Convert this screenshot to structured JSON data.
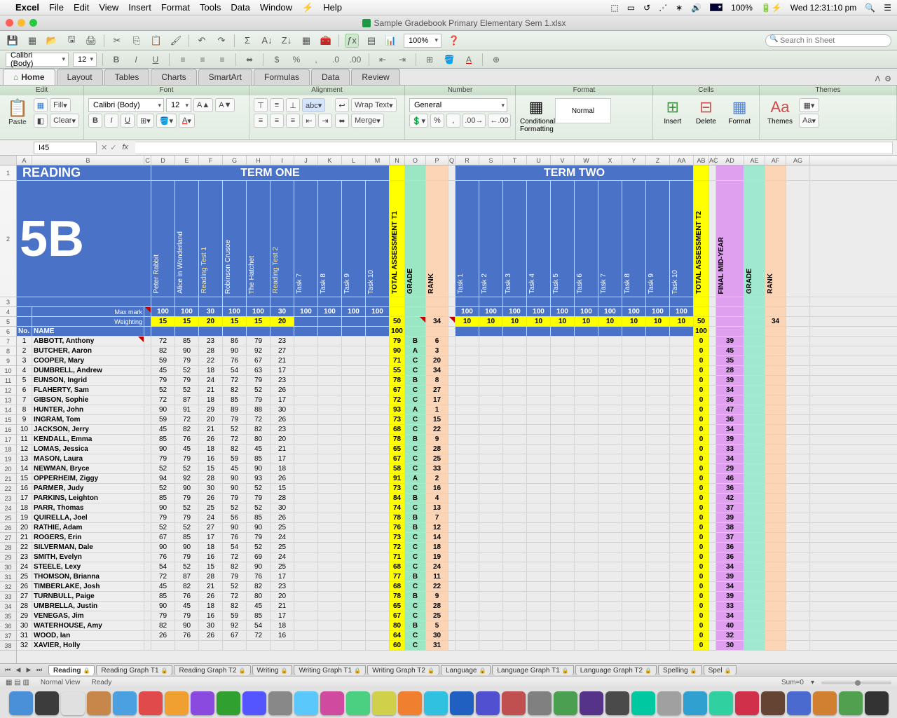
{
  "menubar": {
    "app": "Excel",
    "items": [
      "File",
      "Edit",
      "View",
      "Insert",
      "Format",
      "Tools",
      "Data",
      "Window",
      "Help"
    ],
    "battery": "100%",
    "clock": "Wed 12:31:10 pm"
  },
  "window": {
    "title": "Sample Gradebook Primary Elementary Sem 1.xlsx"
  },
  "qat": {
    "search_placeholder": "Search in Sheet",
    "zoom": "100%"
  },
  "fmt": {
    "font": "Calibri (Body)",
    "size": "12"
  },
  "ribbon": {
    "tabs": [
      "Home",
      "Layout",
      "Tables",
      "Charts",
      "SmartArt",
      "Formulas",
      "Data",
      "Review"
    ],
    "active": "Home",
    "groups": [
      "Edit",
      "Font",
      "Alignment",
      "Number",
      "Format",
      "Cells",
      "Themes"
    ],
    "edit": {
      "paste": "Paste",
      "fill": "Fill",
      "clear": "Clear"
    },
    "font": {
      "name": "Calibri (Body)",
      "size": "12"
    },
    "align": {
      "wrap": "Wrap Text",
      "merge": "Merge"
    },
    "number": {
      "format": "General"
    },
    "format_group": {
      "cond": "Conditional Formatting",
      "normal": "Normal"
    },
    "cells": {
      "insert": "Insert",
      "delete": "Delete",
      "format_btn": "Format"
    },
    "themes": {
      "themes": "Themes",
      "aa": "Aa"
    }
  },
  "formula": {
    "name_box": "I45",
    "fx": "fx"
  },
  "columns": [
    "A",
    "B",
    "C",
    "D",
    "E",
    "F",
    "G",
    "H",
    "I",
    "J",
    "K",
    "L",
    "M",
    "N",
    "O",
    "P",
    "Q",
    "R",
    "S",
    "T",
    "U",
    "V",
    "W",
    "X",
    "Y",
    "Z",
    "AA",
    "AB",
    "AC",
    "AD",
    "AE",
    "AF",
    "AG"
  ],
  "sheet": {
    "reading": "READING",
    "class": "5B",
    "term1": "TERM ONE",
    "term2": "TERM TWO",
    "total_t1": "TOTAL ASSESSMENT T1",
    "total_t2": "TOTAL ASSESSMENT T2",
    "grade": "GRADE",
    "rank": "RANK",
    "final_mid": "FINAL MID-YEAR",
    "max_mark": "Max mark",
    "weighting": "Weighting",
    "no": "No.",
    "name_hdr": "NAME",
    "t1_tasks": [
      "Peter Rabbit",
      "Alice in Wonderland",
      "Reading Test 1",
      "Robinson Crusoe",
      "The Hatchet",
      "Reading Test 2",
      "Task 7",
      "Task 8",
      "Task 9",
      "Task 10"
    ],
    "t2_tasks": [
      "Task 1",
      "Task 2",
      "Task 3",
      "Task 4",
      "Task 5",
      "Task 6",
      "Task 7",
      "Task 8",
      "Task 9",
      "Task 10"
    ],
    "t1_gold_idx": [
      2,
      5
    ],
    "max_row_t1": [
      100,
      100,
      30,
      100,
      100,
      30,
      100,
      100,
      100,
      100
    ],
    "max_row_t2": [
      100,
      100,
      100,
      100,
      100,
      100,
      100,
      100,
      100,
      100
    ],
    "wt_row_t1": [
      15,
      15,
      20,
      15,
      15,
      20
    ],
    "wt_total_t1": 50,
    "wt_rank_t1": 34,
    "wt_row_t2": [
      10,
      10,
      10,
      10,
      10,
      10,
      10,
      10,
      10,
      10
    ],
    "wt_total_t2": 50,
    "wt_rank_t2": 34,
    "row6_t1": 100,
    "row6_t2": 100,
    "students": [
      {
        "no": 1,
        "name": "ABBOTT, Anthony",
        "s": [
          72,
          85,
          23,
          86,
          79,
          23
        ],
        "t1": 79,
        "g": "B",
        "r": 6,
        "t2": 0,
        "m": 39
      },
      {
        "no": 2,
        "name": "BUTCHER, Aaron",
        "s": [
          82,
          90,
          28,
          90,
          92,
          27
        ],
        "t1": 90,
        "g": "A",
        "r": 3,
        "t2": 0,
        "m": 45
      },
      {
        "no": 3,
        "name": "COOPER, Mary",
        "s": [
          59,
          79,
          22,
          76,
          67,
          21
        ],
        "t1": 71,
        "g": "C",
        "r": 20,
        "t2": 0,
        "m": 35
      },
      {
        "no": 4,
        "name": "DUMBRELL, Andrew",
        "s": [
          45,
          52,
          18,
          54,
          63,
          17
        ],
        "t1": 55,
        "g": "C",
        "r": 34,
        "t2": 0,
        "m": 28
      },
      {
        "no": 5,
        "name": "EUNSON, Ingrid",
        "s": [
          79,
          79,
          24,
          72,
          79,
          23
        ],
        "t1": 78,
        "g": "B",
        "r": 8,
        "t2": 0,
        "m": 39
      },
      {
        "no": 6,
        "name": "FLAHERTY, Sam",
        "s": [
          52,
          52,
          21,
          82,
          52,
          26
        ],
        "t1": 67,
        "g": "C",
        "r": 27,
        "t2": 0,
        "m": 34
      },
      {
        "no": 7,
        "name": "GIBSON, Sophie",
        "s": [
          72,
          87,
          18,
          85,
          79,
          17
        ],
        "t1": 72,
        "g": "C",
        "r": 17,
        "t2": 0,
        "m": 36
      },
      {
        "no": 8,
        "name": "HUNTER, John",
        "s": [
          90,
          91,
          29,
          89,
          88,
          30
        ],
        "t1": 93,
        "g": "A",
        "r": 1,
        "t2": 0,
        "m": 47
      },
      {
        "no": 9,
        "name": "INGRAM, Tom",
        "s": [
          59,
          72,
          20,
          79,
          72,
          26
        ],
        "t1": 73,
        "g": "C",
        "r": 15,
        "t2": 0,
        "m": 36
      },
      {
        "no": 10,
        "name": "JACKSON, Jerry",
        "s": [
          45,
          82,
          21,
          52,
          82,
          23
        ],
        "t1": 68,
        "g": "C",
        "r": 22,
        "t2": 0,
        "m": 34
      },
      {
        "no": 11,
        "name": "KENDALL, Emma",
        "s": [
          85,
          76,
          26,
          72,
          80,
          20
        ],
        "t1": 78,
        "g": "B",
        "r": 9,
        "t2": 0,
        "m": 39
      },
      {
        "no": 12,
        "name": "LOMAS, Jessica",
        "s": [
          90,
          45,
          18,
          82,
          45,
          21
        ],
        "t1": 65,
        "g": "C",
        "r": 28,
        "t2": 0,
        "m": 33
      },
      {
        "no": 13,
        "name": "MASON, Laura",
        "s": [
          79,
          79,
          16,
          59,
          85,
          17
        ],
        "t1": 67,
        "g": "C",
        "r": 25,
        "t2": 0,
        "m": 34
      },
      {
        "no": 14,
        "name": "NEWMAN, Bryce",
        "s": [
          52,
          52,
          15,
          45,
          90,
          18
        ],
        "t1": 58,
        "g": "C",
        "r": 33,
        "t2": 0,
        "m": 29
      },
      {
        "no": 15,
        "name": "OPPERHEIM, Ziggy",
        "s": [
          94,
          92,
          28,
          90,
          93,
          26
        ],
        "t1": 91,
        "g": "A",
        "r": 2,
        "t2": 0,
        "m": 46
      },
      {
        "no": 16,
        "name": "PARMER, Judy",
        "s": [
          52,
          90,
          30,
          90,
          52,
          15
        ],
        "t1": 73,
        "g": "C",
        "r": 16,
        "t2": 0,
        "m": 36
      },
      {
        "no": 17,
        "name": "PARKINS, Leighton",
        "s": [
          85,
          79,
          26,
          79,
          79,
          28
        ],
        "t1": 84,
        "g": "B",
        "r": 4,
        "t2": 0,
        "m": 42
      },
      {
        "no": 18,
        "name": "PARR, Thomas",
        "s": [
          90,
          52,
          25,
          52,
          52,
          30
        ],
        "t1": 74,
        "g": "C",
        "r": 13,
        "t2": 0,
        "m": 37
      },
      {
        "no": 19,
        "name": "QUIRELLA, Joel",
        "s": [
          79,
          79,
          24,
          56,
          85,
          26
        ],
        "t1": 78,
        "g": "B",
        "r": 7,
        "t2": 0,
        "m": 39
      },
      {
        "no": 20,
        "name": "RATHIE, Adam",
        "s": [
          52,
          52,
          27,
          90,
          90,
          25
        ],
        "t1": 76,
        "g": "B",
        "r": 12,
        "t2": 0,
        "m": 38
      },
      {
        "no": 21,
        "name": "ROGERS, Erin",
        "s": [
          67,
          85,
          17,
          76,
          79,
          24
        ],
        "t1": 73,
        "g": "C",
        "r": 14,
        "t2": 0,
        "m": 37
      },
      {
        "no": 22,
        "name": "SILVERMAN, Dale",
        "s": [
          90,
          90,
          18,
          54,
          52,
          25
        ],
        "t1": 72,
        "g": "C",
        "r": 18,
        "t2": 0,
        "m": 36
      },
      {
        "no": 23,
        "name": "SMITH, Evelyn",
        "s": [
          76,
          79,
          16,
          72,
          69,
          24
        ],
        "t1": 71,
        "g": "C",
        "r": 19,
        "t2": 0,
        "m": 36
      },
      {
        "no": 24,
        "name": "STEELE, Lexy",
        "s": [
          54,
          52,
          15,
          82,
          90,
          25
        ],
        "t1": 68,
        "g": "C",
        "r": 24,
        "t2": 0,
        "m": 34
      },
      {
        "no": 25,
        "name": "THOMSON, Brianna",
        "s": [
          72,
          87,
          28,
          79,
          76,
          17
        ],
        "t1": 77,
        "g": "B",
        "r": 11,
        "t2": 0,
        "m": 39
      },
      {
        "no": 26,
        "name": "TIMBERLAKE, Josh",
        "s": [
          45,
          82,
          21,
          52,
          82,
          23
        ],
        "t1": 68,
        "g": "C",
        "r": 22,
        "t2": 0,
        "m": 34
      },
      {
        "no": 27,
        "name": "TURNBULL, Paige",
        "s": [
          85,
          76,
          26,
          72,
          80,
          20
        ],
        "t1": 78,
        "g": "B",
        "r": 9,
        "t2": 0,
        "m": 39
      },
      {
        "no": 28,
        "name": "UMBRELLA, Justin",
        "s": [
          90,
          45,
          18,
          82,
          45,
          21
        ],
        "t1": 65,
        "g": "C",
        "r": 28,
        "t2": 0,
        "m": 33
      },
      {
        "no": 29,
        "name": "VENEGAS, Jim",
        "s": [
          79,
          79,
          16,
          59,
          85,
          17
        ],
        "t1": 67,
        "g": "C",
        "r": 25,
        "t2": 0,
        "m": 34
      },
      {
        "no": 30,
        "name": "WATERHOUSE, Amy",
        "s": [
          82,
          90,
          30,
          92,
          54,
          18
        ],
        "t1": 80,
        "g": "B",
        "r": 5,
        "t2": 0,
        "m": 40
      },
      {
        "no": 31,
        "name": "WOOD, Ian",
        "s": [
          26,
          76,
          26,
          67,
          72,
          16
        ],
        "t1": 64,
        "g": "C",
        "r": 30,
        "t2": 0,
        "m": 32
      },
      {
        "no": 32,
        "name": "XAVIER, Holly",
        "s": [
          "",
          "",
          "",
          "",
          "",
          ""
        ],
        "t1": 60,
        "g": "C",
        "r": 31,
        "t2": 0,
        "m": 30
      }
    ]
  },
  "tabs": [
    "Reading",
    "Reading Graph T1",
    "Reading Graph T2",
    "Writing",
    "Writing Graph T1",
    "Writing Graph T2",
    "Language",
    "Language Graph T1",
    "Language Graph T2",
    "Spelling",
    "Spel"
  ],
  "active_tab": 0,
  "status": {
    "view": "Normal View",
    "ready": "Ready",
    "sum": "Sum=0"
  },
  "dock_colors": [
    "#4a90d9",
    "#3c3c3c",
    "#e0e0e0",
    "#c8874a",
    "#4aa0e0",
    "#e04a4a",
    "#f0a030",
    "#8a4ae0",
    "#30a030",
    "#5555ff",
    "#888",
    "#5ac8fa",
    "#d04aa0",
    "#4ad080",
    "#d0d04a",
    "#f08030",
    "#30c0e0",
    "#2060c0",
    "#5050d0",
    "#c05050",
    "#808080",
    "#4aa050",
    "#553388",
    "#4a4a4a",
    "#00c8a0",
    "#a0a0a0",
    "#30a0d0",
    "#30d0a0",
    "#d0304a",
    "#664433",
    "#4a6ad0",
    "#d08030",
    "#50a050",
    "#333"
  ]
}
